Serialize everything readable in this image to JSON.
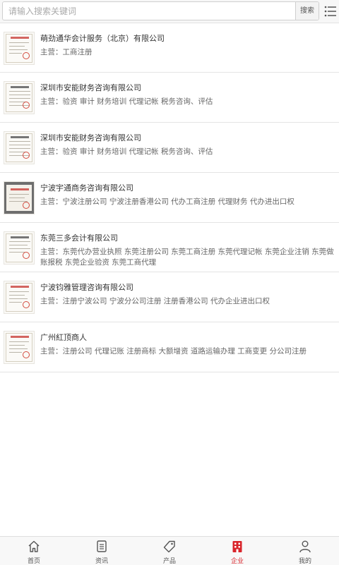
{
  "search": {
    "placeholder": "请输入搜索关键词",
    "button": "搜索"
  },
  "companies": [
    {
      "name": "萌劲通华会计服务（北京）有限公司",
      "prefix": "主营：",
      "business": "工商注册"
    },
    {
      "name": "深圳市安能财务咨询有限公司",
      "prefix": "主营：",
      "business": "验资 审计 财务培训 代理记帐 税务咨询、评估"
    },
    {
      "name": "深圳市安能财务咨询有限公司",
      "prefix": "主营：",
      "business": "验资 审计 财务培训 代理记帐 税务咨询、评估"
    },
    {
      "name": "宁波宇通商务咨询有限公司",
      "prefix": "主营：",
      "business": "宁波注册公司 宁波注册香港公司 代办工商注册 代理财务 代办进出口权"
    },
    {
      "name": "东莞三多会计有限公司",
      "prefix": "主营：",
      "business": "东莞代办营业执照 东莞注册公司 东莞工商注册 东莞代理记帐 东莞企业注销 东莞做账报税 东莞企业验资 东莞工商代理"
    },
    {
      "name": "宁波钧雅管理咨询有限公司",
      "prefix": "主营：",
      "business": "注册宁波公司 宁波分公司注册 注册香港公司 代办企业进出口权"
    },
    {
      "name": "广州紅顶商人",
      "prefix": "主营：",
      "business": "注册公司 代理记账 注册商标 大额增资 道路运输办理 工商变更 分公司注册"
    }
  ],
  "nav": [
    {
      "label": "首页",
      "icon": "home-icon"
    },
    {
      "label": "资讯",
      "icon": "news-icon"
    },
    {
      "label": "产品",
      "icon": "tag-icon"
    },
    {
      "label": "企业",
      "icon": "building-icon"
    },
    {
      "label": "我的",
      "icon": "user-icon"
    }
  ],
  "colors": {
    "accent": "#d9252b",
    "text": "#333333",
    "muted": "#666666"
  }
}
